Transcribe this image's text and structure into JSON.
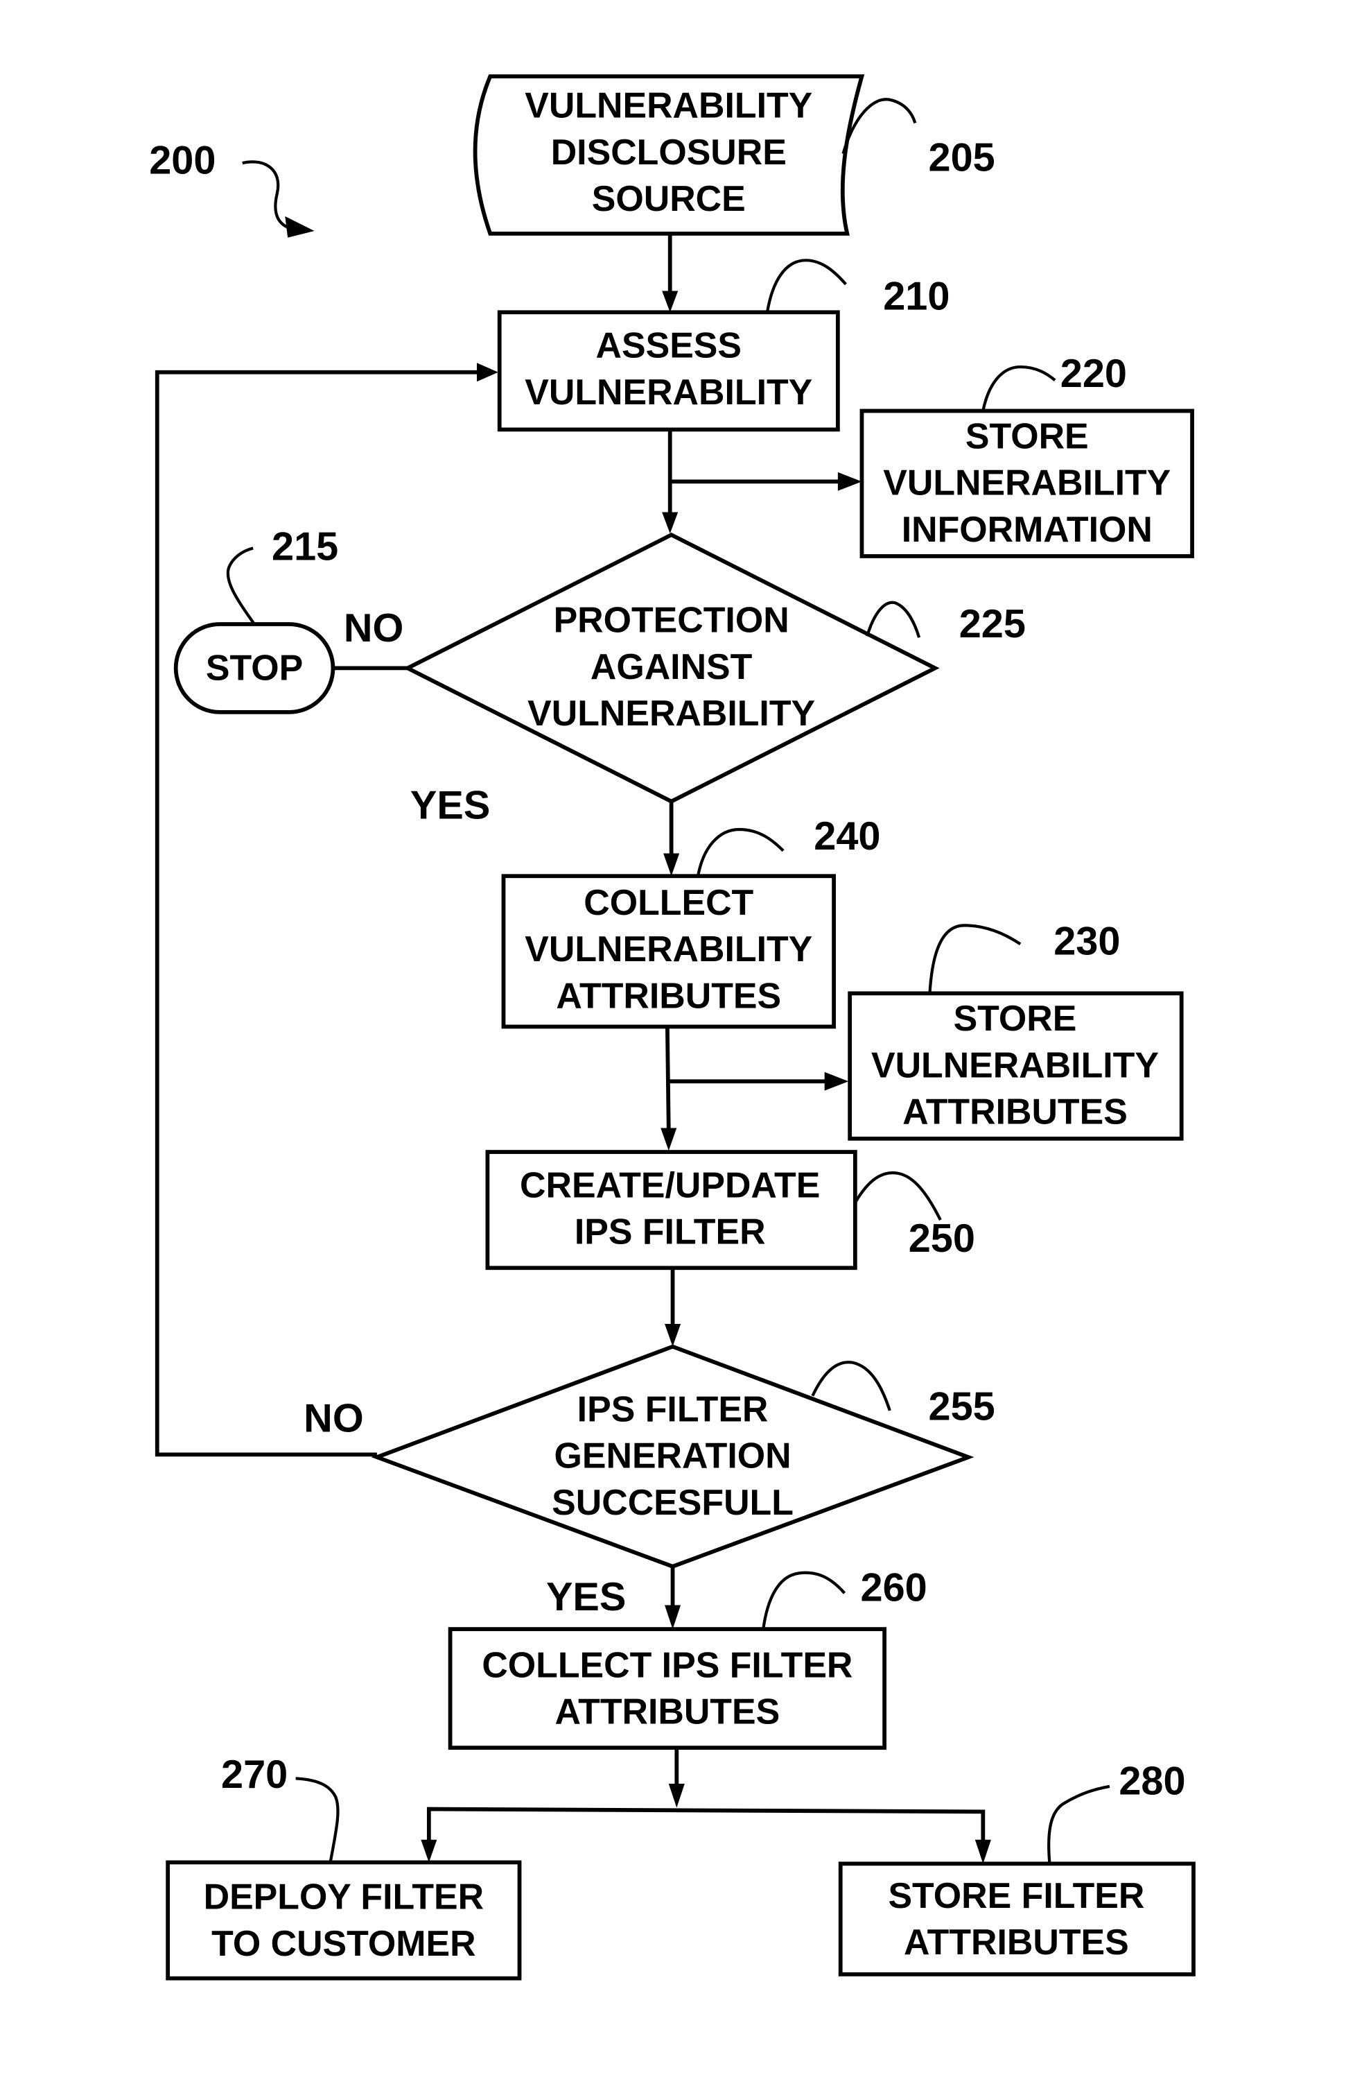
{
  "figure": {
    "ref": "200"
  },
  "nodes": {
    "source": {
      "ref": "205",
      "lines": [
        "VULNERABILITY",
        "DISCLOSURE",
        "SOURCE"
      ]
    },
    "assess": {
      "ref": "210",
      "lines": [
        "ASSESS",
        "VULNERABILITY"
      ]
    },
    "stop": {
      "ref": "215",
      "lines": [
        "STOP"
      ]
    },
    "store_info": {
      "ref": "220",
      "lines": [
        "STORE",
        "VULNERABILITY",
        "INFORMATION"
      ]
    },
    "protection": {
      "ref": "225",
      "lines": [
        "PROTECTION",
        "AGAINST",
        "VULNERABILITY"
      ]
    },
    "store_attrs": {
      "ref": "230",
      "lines": [
        "STORE",
        "VULNERABILITY",
        "ATTRIBUTES"
      ]
    },
    "collect": {
      "ref": "240",
      "lines": [
        "COLLECT",
        "VULNERABILITY",
        "ATTRIBUTES"
      ]
    },
    "create": {
      "ref": "250",
      "lines": [
        "CREATE/UPDATE",
        "IPS FILTER"
      ]
    },
    "success": {
      "ref": "255",
      "lines": [
        "IPS FILTER",
        "GENERATION",
        "SUCCESFULL"
      ]
    },
    "collect_ips": {
      "ref": "260",
      "lines": [
        "COLLECT IPS FILTER",
        "ATTRIBUTES"
      ]
    },
    "deploy": {
      "ref": "270",
      "lines": [
        "DEPLOY FILTER",
        "TO CUSTOMER"
      ]
    },
    "store_filter": {
      "ref": "280",
      "lines": [
        "STORE  FILTER",
        "ATTRIBUTES"
      ]
    }
  },
  "branches": {
    "protection_no": "NO",
    "protection_yes": "YES",
    "success_no": "NO",
    "success_yes": "YES"
  }
}
